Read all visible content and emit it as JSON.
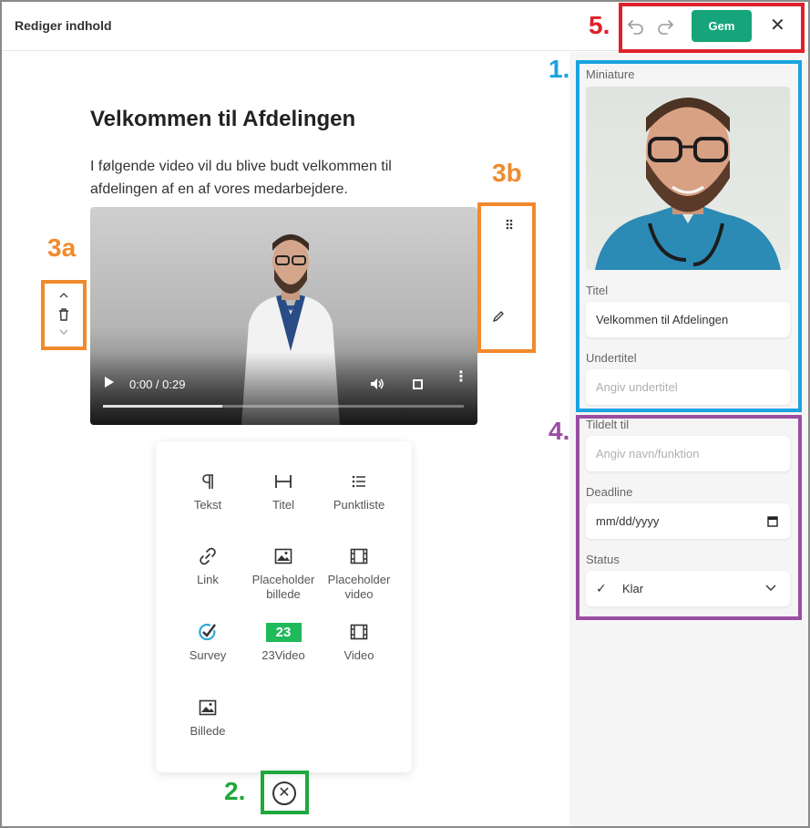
{
  "header": {
    "title": "Rediger indhold",
    "save_label": "Gem",
    "close_glyph": "✕"
  },
  "content": {
    "title": "Velkommen til Afdelingen",
    "intro": "I følgende video vil du blive budt velkommen til afdelingen af en af vores medarbejdere.",
    "video": {
      "time": "0:00 / 0:29",
      "progress": 0.33
    }
  },
  "annotations": {
    "a1": "1.",
    "a2": "2.",
    "a3a": "3a",
    "a3b": "3b",
    "a4": "4.",
    "a5": "5.",
    "colors": {
      "blue": "#1aa3e0",
      "green": "#1fa83c",
      "orange": "#f08a2c",
      "purple": "#9a4ea3",
      "red": "#e0202a"
    }
  },
  "insert_menu": {
    "items": [
      {
        "label": "Tekst",
        "icon": "paragraph-icon"
      },
      {
        "label": "Titel",
        "icon": "heading-icon"
      },
      {
        "label": "Punktliste",
        "icon": "bullet-list-icon"
      },
      {
        "label": "Link",
        "icon": "link-icon"
      },
      {
        "label": "Placeholder billede",
        "icon": "image-icon"
      },
      {
        "label": "Placeholder video",
        "icon": "film-icon"
      },
      {
        "label": "Survey",
        "icon": "survey-check-icon"
      },
      {
        "label": "23Video",
        "icon": "23video-logo",
        "badge": "23"
      },
      {
        "label": "Video",
        "icon": "film-icon"
      },
      {
        "label": "Billede",
        "icon": "image-icon"
      }
    ]
  },
  "sidebar": {
    "thumbnail_label": "Miniature",
    "title_label": "Titel",
    "title_value": "Velkommen til Afdelingen",
    "subtitle_label": "Undertitel",
    "subtitle_placeholder": "Angiv undertitel",
    "assigned_label": "Tildelt til",
    "assigned_placeholder": "Angiv navn/funktion",
    "deadline_label": "Deadline",
    "deadline_placeholder": "mm/dd/yyyy",
    "status_label": "Status",
    "status_value": "Klar",
    "status_check": "✓"
  },
  "colors": {
    "accent": "#16a57a"
  }
}
